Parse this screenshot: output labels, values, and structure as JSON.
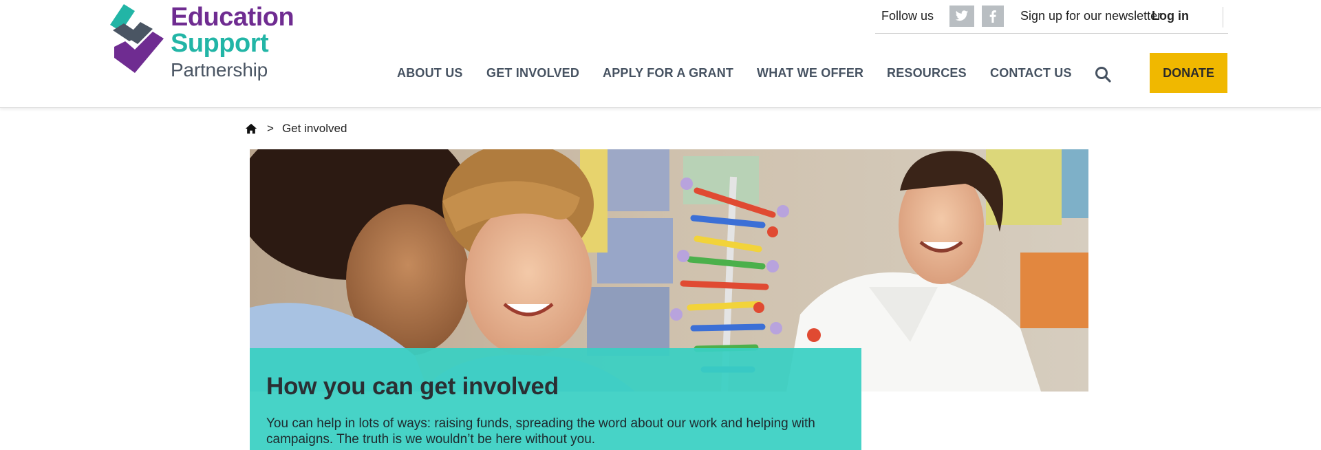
{
  "brand": {
    "line1": "Education",
    "line2": "Support",
    "line3": "Partnership",
    "colors": {
      "purple": "#6f2c91",
      "teal": "#22b5a6",
      "slate": "#4a5563"
    }
  },
  "topbar": {
    "follow_label": "Follow us",
    "twitter_icon": "twitter-icon",
    "facebook_icon": "facebook-icon",
    "newsletter_label": "Sign up for our newsletter",
    "login_label": "Log in"
  },
  "nav": {
    "items": [
      {
        "label": "ABOUT US"
      },
      {
        "label": "GET INVOLVED"
      },
      {
        "label": "APPLY FOR A GRANT"
      },
      {
        "label": "WHAT WE OFFER"
      },
      {
        "label": "RESOURCES"
      },
      {
        "label": "CONTACT US"
      }
    ],
    "search_icon": "search-icon",
    "donate_label": "DONATE",
    "donate_color": "#f0b800"
  },
  "breadcrumb": {
    "home_icon": "home-icon",
    "separator": ">",
    "current": "Get involved"
  },
  "hero": {
    "title": "How you can get involved",
    "text": "You can help in lots of ways: raising funds, spreading the word about our work and helping with campaigns. The truth is we wouldn’t be here without you.",
    "overlay_color": "#39d0c3"
  }
}
